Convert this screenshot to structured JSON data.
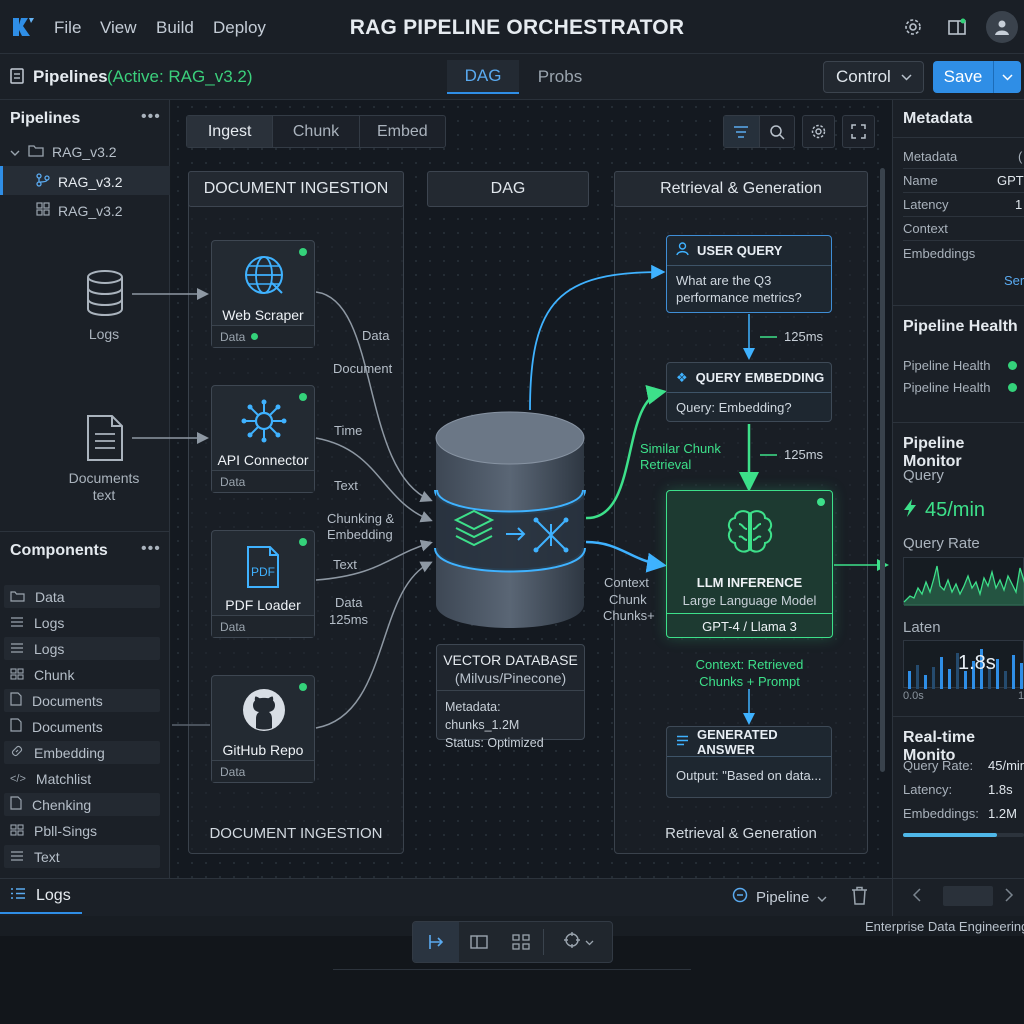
{
  "menu": {
    "file": "File",
    "view": "View",
    "build": "Build",
    "deploy": "Deploy"
  },
  "app_title": "RAG PIPELINE ORCHESTRATOR",
  "toolbar": {
    "pipelines_label": "Pipelines",
    "active_label": "(Active: RAG_v3.2)",
    "tab_dag": "DAG",
    "tab_probs": "Probs",
    "control_label": "Control",
    "save_label": "Save"
  },
  "sidebar": {
    "pipelines_title": "Pipelines",
    "tree": [
      "RAG_v3.2",
      "RAG_v3.2",
      "RAG_v3.2"
    ],
    "source_logs": "Logs",
    "source_docs": [
      "Documents",
      "text"
    ],
    "components_title": "Components",
    "components": [
      "Data",
      "Logs",
      "Logs",
      "Chunk",
      "Documents",
      "Documents",
      "Embedding",
      "Matchlist",
      "Chenking",
      "Pbll-Sings",
      "Text"
    ]
  },
  "canvas": {
    "tabs": [
      "Ingest",
      "Chunk",
      "Embed"
    ],
    "col_ingestion": "DOCUMENT INGESTION",
    "col_dag": "DAG",
    "col_retrieval": "Retrieval & Generation",
    "footer_ingestion": "DOCUMENT INGESTION",
    "footer_retrieval": "Retrieval & Generation",
    "sources": [
      {
        "title": "Web Scraper",
        "foot": "Data"
      },
      {
        "title": "API Connector",
        "foot": "Data"
      },
      {
        "title": "PDF Loader",
        "foot": "Data"
      },
      {
        "title": "GitHub Repo",
        "foot": "Data"
      }
    ],
    "pdf_badge": "PDF",
    "edge_labels": {
      "data1": "Data",
      "document": "Document",
      "time": "Time",
      "text1": "Text",
      "chunking": "Chunking &",
      "embedding": "Embedding",
      "text2": "Text",
      "data2": "Data",
      "ms": "125ms",
      "context": "Context",
      "chunk": "Chunk",
      "chunks": "Chunks+"
    },
    "vector_db": {
      "title": "VECTOR DATABASE",
      "subtitle": "(Milvus/Pinecone)",
      "meta": "Metadata: chunks_1.2M",
      "status": "Status: Optimized"
    },
    "user_query": {
      "title": "USER QUERY",
      "body": "What are the Q3 performance metrics?"
    },
    "latency1": "125ms",
    "query_embedding": {
      "title": "QUERY EMBEDDING",
      "body": "Query: Embedding?"
    },
    "latency2": "125ms",
    "similar": [
      "Similar Chunk",
      "Retrieval"
    ],
    "llm": {
      "title": "LLM INFERENCE",
      "subtitle": "Large Language Model",
      "model": "GPT-4 / Llama 3"
    },
    "context_note": [
      "Context: Retrieved",
      "Chunks + Prompt"
    ],
    "answer": {
      "title": "GENERATED ANSWER",
      "body": "Output: \"Based on data..."
    }
  },
  "right_panel": {
    "metadata_title": "Metadata",
    "metadata_rows": [
      "Metadata",
      "Name",
      "Latency",
      "Context",
      "Embeddings"
    ],
    "metadata_vals": [
      "(",
      "GPT",
      "1",
      "",
      ""
    ],
    "see_more": "Ser",
    "health_title": "Pipeline Health",
    "health_rows": [
      "Pipeline Health",
      "Pipeline Health"
    ],
    "monitor_title": "Pipeline Monitor",
    "query_label": "Query",
    "query_value": "45/min",
    "query_rate_label": "Query Rate",
    "latency_label": "Laten",
    "latency_value": "1.8s",
    "latency_axis": "0.0s",
    "latency_axis2": "1",
    "realtime_title": "Real-time Monito",
    "realtime_rows": [
      {
        "k": "Query Rate:",
        "v": "45/min"
      },
      {
        "k": "Latency:",
        "v": "1.8s"
      },
      {
        "k": "Embeddings:",
        "v": "1.2M"
      }
    ],
    "progress": 0.78
  },
  "bottom": {
    "logs_tab": "Logs",
    "pipeline_select": "Pipeline",
    "footer_text": "Enterprise Data Engineering"
  },
  "colors": {
    "accent": "#2f8ee6",
    "green": "#34d27a",
    "cyan": "#3fb2ff"
  }
}
